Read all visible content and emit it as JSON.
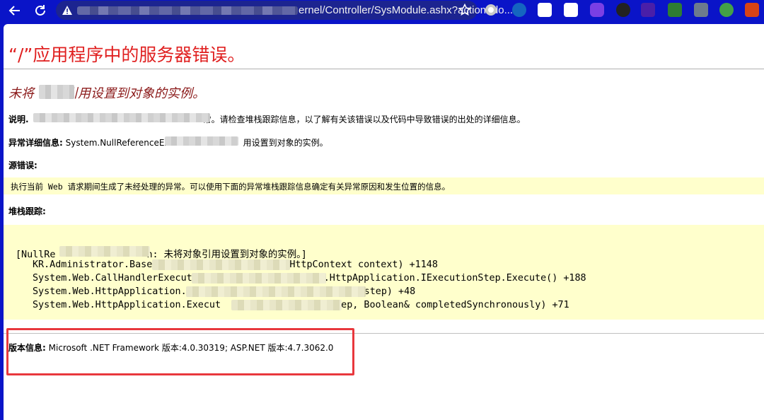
{
  "browser": {
    "url_visible": "ernel/Controller/SysModule.ashx?action=do..."
  },
  "page": {
    "title": "“/”应用程序中的服务器错误。",
    "subtitle_start": "未将",
    "subtitle_end": "引用设置到对象的实例。",
    "description_label": "说明.",
    "description_text": "常。请检查堆栈跟踪信息，以了解有关该错误以及代码中导致错误的出处的详细信息。",
    "exception_label": "异常详细信息:",
    "exception_start": "System.NullReferenceEx",
    "exception_end": "用设置到对象的实例。",
    "source_label": "源错误:",
    "source_text": "执行当前 Web 请求期间生成了未经处理的异常。可以使用下面的异常堆栈跟踪信息确定有关异常原因和发生位置的信息。",
    "stack_label": "堆栈跟踪:",
    "stack": {
      "l1_start": "[NullRe",
      "l1_end": "n: 未将对象引用设置到对象的实例。]",
      "l2_start": "KR.Administrator.Base",
      "l2_end": "HttpContext context) +1148",
      "l3_start": "System.Web.CallHandlerExecut",
      "l3_end": ".HttpApplication.IExecutionStep.Execute() +188",
      "l4_start": "System.Web.HttpApplication.",
      "l4_end": "step) +48",
      "l5_start": "System.Web.HttpApplication.Execut",
      "l5_end": "Step, Boolean& completedSynchronously) +71"
    },
    "version_label": "版本信息:",
    "version_text": "Microsoft .NET Framework 版本:4.0.30319; ASP.NET 版本:4.7.3062.0"
  },
  "colors": {
    "browser_chrome": "#0a14c8",
    "title_red": "#e02020",
    "subtitle_dark_red": "#8b1a1a",
    "code_background": "#ffffcc",
    "highlight_box": "#e8383d"
  }
}
